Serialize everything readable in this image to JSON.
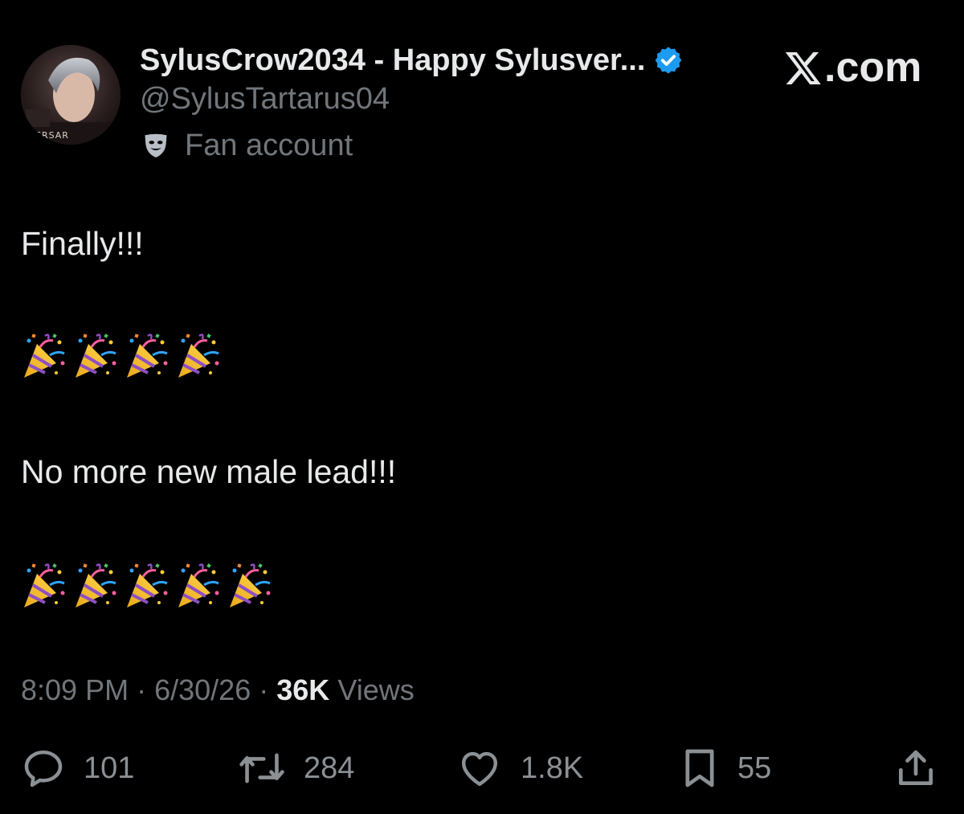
{
  "author": {
    "display_name": "SylusCrow2034 - Happy Sylusver...",
    "handle": "@SylusTartarus04",
    "label": "Fan account",
    "avatar_text": "ERSAR"
  },
  "brand": {
    "site": ".com"
  },
  "tweet": {
    "line1": "Finally!!!",
    "emoji_row1_count": 4,
    "line2": "No more new male lead!!!",
    "emoji_row2_count": 5
  },
  "meta": {
    "time": "8:09 PM",
    "date": "6/30/26",
    "views_count": "36K",
    "views_label": "Views",
    "separator": "·"
  },
  "actions": {
    "replies": "101",
    "reposts": "284",
    "likes": "1.8K",
    "bookmarks": "55"
  },
  "colors": {
    "background": "#000000",
    "text": "#e7e9ea",
    "muted": "#71767b",
    "verified": "#1d9bf0"
  },
  "icons": {
    "verified": "verified-badge-icon",
    "label": "theater-mask-icon",
    "reply": "reply-icon",
    "repost": "repost-icon",
    "like": "heart-icon",
    "bookmark": "bookmark-icon",
    "share": "share-icon",
    "emoji": "party-popper-icon"
  }
}
